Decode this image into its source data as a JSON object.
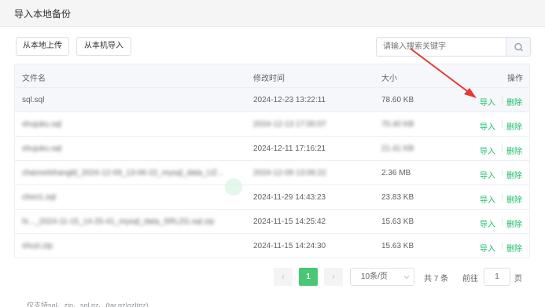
{
  "dialog": {
    "title": "导入本地备份"
  },
  "toolbar": {
    "upload_local_label": "从本地上传",
    "import_machine_label": "从本机导入",
    "search_placeholder": "请输入搜索关键字"
  },
  "table": {
    "headers": {
      "name": "文件名",
      "modified": "修改时间",
      "size": "大小",
      "actions": "操作"
    },
    "rows": [
      {
        "name": "sql.sql",
        "modified": "2024-12-23 13:22:11",
        "size": "78.60 KB",
        "import": "导入",
        "delete": "删除"
      },
      {
        "name": "shujuku.sql",
        "modified": "2024-12-13 17:00:07",
        "size": "70.40 KB",
        "import": "导入",
        "delete": "删除"
      },
      {
        "name": "shujuku.sql",
        "modified": "2024-12-11 17:16:21",
        "size": "21.41 KB",
        "import": "导入",
        "delete": "删除"
      },
      {
        "name": "channelshangld_2024-12-09_13-06-22_mysql_data_UZ...",
        "modified": "2024-12-09 13:06:22",
        "size": "2.36 MB",
        "import": "导入",
        "delete": "删除"
      },
      {
        "name": "chen1.sql",
        "modified": "2024-11-29 14:43:23",
        "size": "23.83 KB",
        "import": "导入",
        "delete": "删除"
      },
      {
        "name": "hi..._2024-11-15_14-25-41_mysql_data_SRLZG.sql.zip",
        "modified": "2024-11-15 14:25:42",
        "size": "15.63 KB",
        "import": "导入",
        "delete": "删除"
      },
      {
        "name": "shuzi.zip",
        "modified": "2024-11-15 14:24:30",
        "size": "15.63 KB",
        "import": "导入",
        "delete": "删除"
      }
    ]
  },
  "pagination": {
    "prev": "‹",
    "current_page": "1",
    "next": "›",
    "page_size": "10条/页",
    "total": "共 7 条",
    "goto_prefix": "前往",
    "goto_value": "1",
    "goto_suffix": "页"
  },
  "footnote": "仅支持sql、zip、sql.gz、(tar.gz|gz|tgz)",
  "colors": {
    "accent": "#19be6b",
    "pager_active": "#48c774",
    "annotation_arrow": "#e53935"
  }
}
